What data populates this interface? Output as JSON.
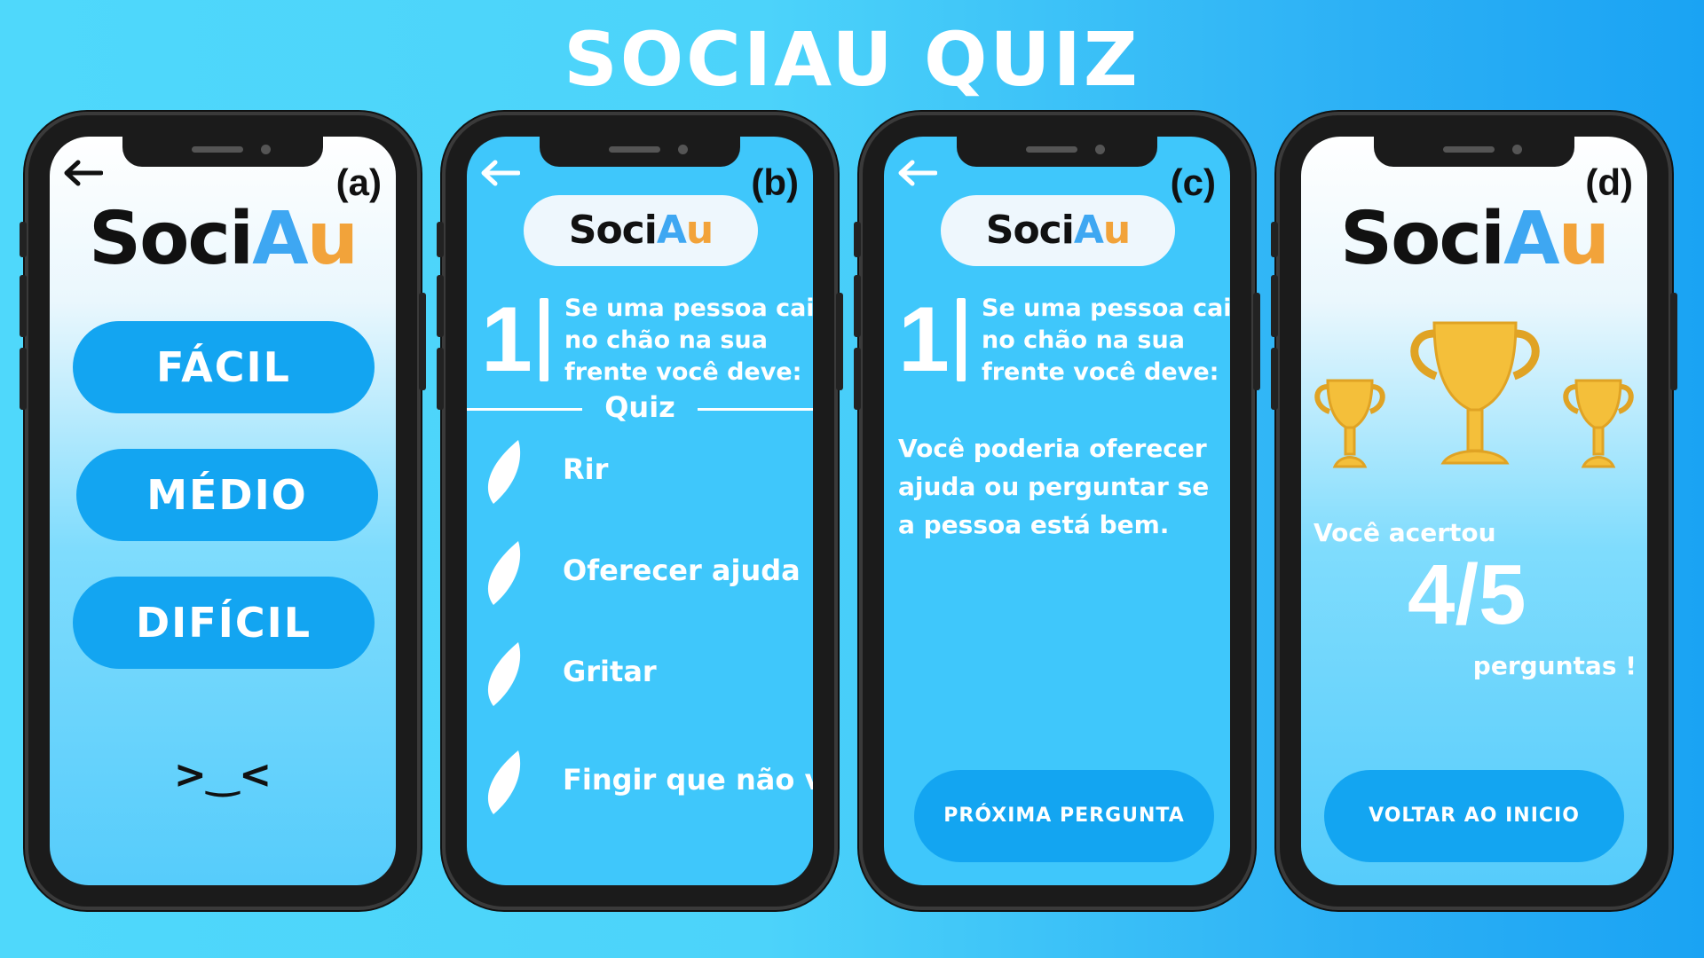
{
  "title": "SOCIAU QUIZ",
  "logo": {
    "part1": "Soci",
    "part2": "A",
    "part3": "u"
  },
  "panels": {
    "a": {
      "label": "(a)",
      "levels": [
        "FÁCIL",
        "MÉDIO",
        "DIFÍCIL"
      ],
      "face": ">‿<"
    },
    "b": {
      "label": "(b)",
      "question_number": "1",
      "question": "Se uma pessoa cai no chão na sua frente você deve:",
      "section_label": "Quiz",
      "options": [
        "Rir",
        "Oferecer ajuda",
        "Gritar",
        "Fingir que não viu"
      ]
    },
    "c": {
      "label": "(c)",
      "question_number": "1",
      "question": "Se uma pessoa cai no chão na sua frente você deve:",
      "answer": "Você poderia oferecer ajuda ou perguntar se a pessoa está bem.",
      "next_button": "PRÓXIMA PERGUNTA"
    },
    "d": {
      "label": "(d)",
      "result_prefix": "Você acertou",
      "score": "4/5",
      "result_suffix": "perguntas !",
      "home_button": "VOLTAR AO INICIO"
    }
  },
  "colors": {
    "button_blue": "#13a5f1",
    "trophy_gold": "#f4bf3a",
    "logo_a": "#3ea7f2",
    "logo_u": "#f2a33a"
  },
  "icons": {
    "back": "arrow-left-icon",
    "option": "leaf-icon",
    "trophy": "trophy-icon"
  }
}
